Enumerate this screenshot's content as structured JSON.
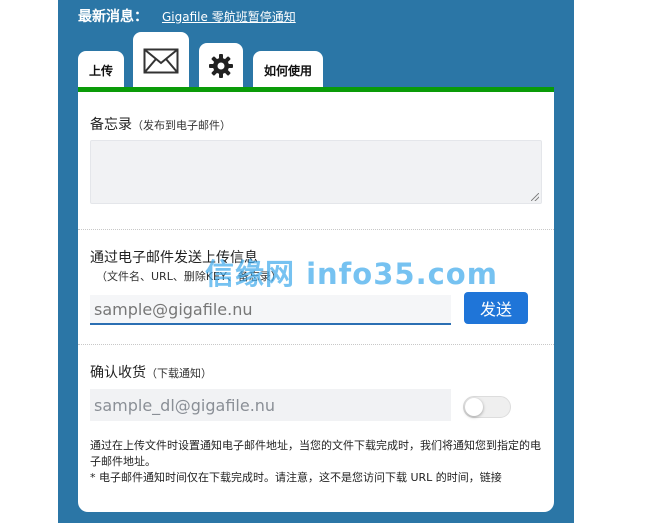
{
  "news": {
    "label": "最新消息：",
    "link": "Gigafile 零航班暂停通知"
  },
  "tabs": {
    "upload": "上传",
    "mail_icon": "envelope-icon",
    "gear_icon": "gear-icon",
    "help": "如何使用"
  },
  "note": {
    "title": "备忘录",
    "subtitle": "（发布到电子邮件）",
    "value": ""
  },
  "send": {
    "title": "通过电子邮件发送上传信息",
    "subtitle": "（文件名、URL、删除KEY、备忘录）",
    "placeholder": "sample@gigafile.nu",
    "button": "发送"
  },
  "confirm": {
    "title": "确认收货",
    "subtitle": "（下载通知）",
    "placeholder": "sample_dl@gigafile.nu",
    "toggle_on": false
  },
  "description": {
    "line1": "通过在上传文件时设置通知电子邮件地址，当您的文件下载完成时，我们将通知您到指定的电子邮件地址。",
    "line2": "* 电子邮件通知时间仅在下载完成时。请注意，这不是您访问下载 URL 的时间，链接"
  },
  "watermark": "信缘网 info35.com",
  "colors": {
    "frame": "#2b76a6",
    "accent_bar": "#0a9b08",
    "send_button": "#1f75d8"
  }
}
